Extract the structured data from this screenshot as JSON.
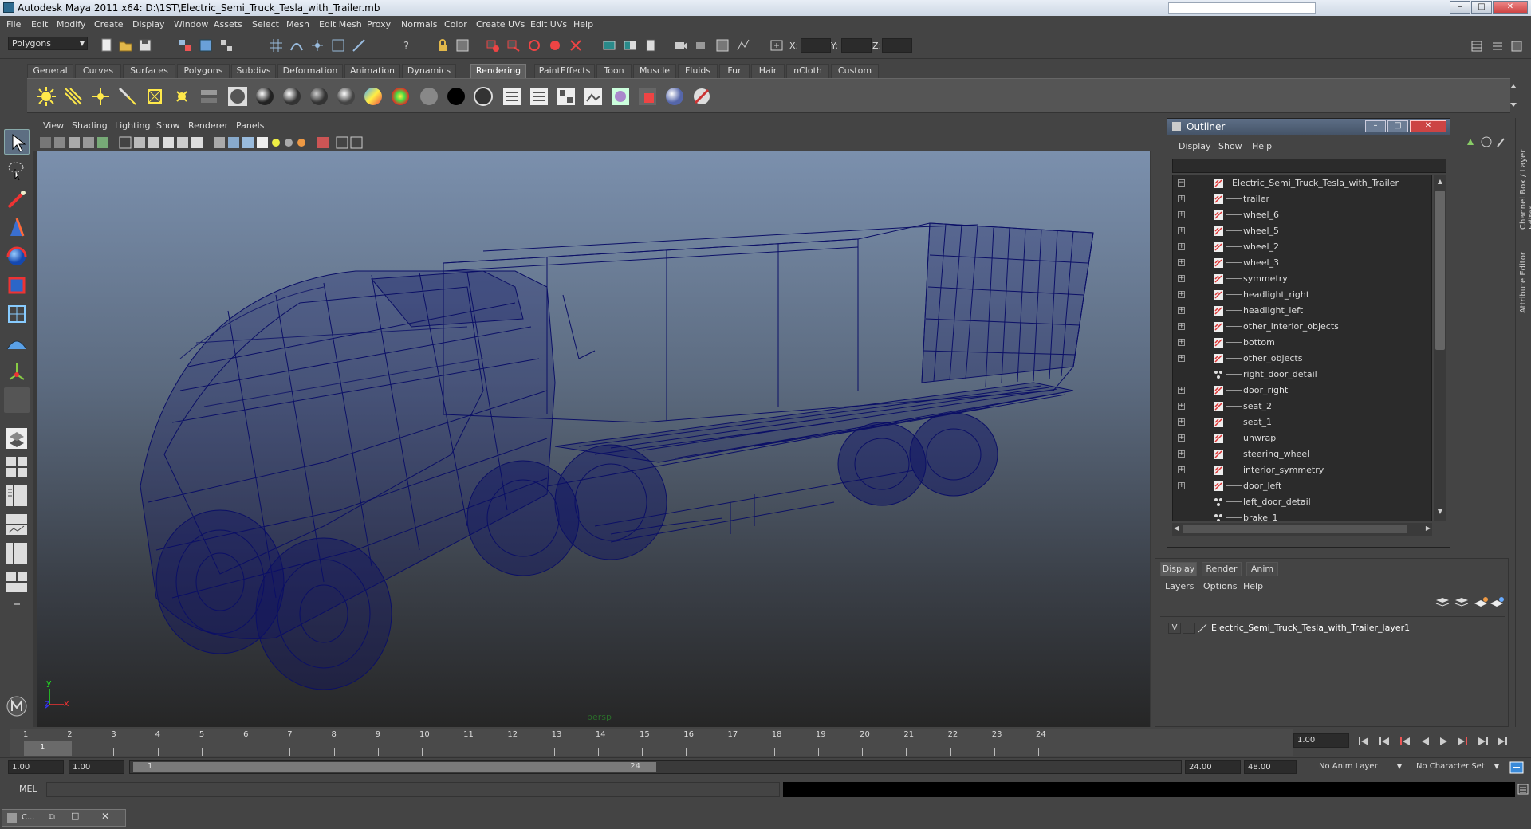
{
  "window": {
    "title": "Autodesk Maya 2011 x64: D:\\1ST\\Electric_Semi_Truck_Tesla_with_Trailer.mb"
  },
  "menubar": [
    "File",
    "Edit",
    "Modify",
    "Create",
    "Display",
    "Window",
    "Assets",
    "Select",
    "Mesh",
    "Edit Mesh",
    "Proxy",
    "Normals",
    "Color",
    "Create UVs",
    "Edit UVs",
    "Help"
  ],
  "statusline": {
    "mode": "Polygons",
    "x_label": "X:",
    "y_label": "Y:",
    "z_label": "Z:"
  },
  "shelf_tabs": [
    "General",
    "Curves",
    "Surfaces",
    "Polygons",
    "Subdivs",
    "Deformation",
    "Animation",
    "Dynamics",
    "Rendering",
    "PaintEffects",
    "Toon",
    "Muscle",
    "Fluids",
    "Fur",
    "Hair",
    "nCloth",
    "Custom"
  ],
  "active_shelf": "Rendering",
  "viewport": {
    "menus": [
      "View",
      "Shading",
      "Lighting",
      "Show",
      "Renderer",
      "Panels"
    ],
    "camera_label": "persp",
    "axis_y": "y",
    "axis_x": "x",
    "axis_z": "z"
  },
  "outliner": {
    "title": "Outliner",
    "menus": [
      "Display",
      "Show",
      "Help"
    ],
    "root": "Electric_Semi_Truck_Tesla_with_Trailer",
    "items": [
      {
        "name": "trailer",
        "type": "mesh"
      },
      {
        "name": "wheel_6",
        "type": "mesh"
      },
      {
        "name": "wheel_5",
        "type": "mesh"
      },
      {
        "name": "wheel_2",
        "type": "mesh"
      },
      {
        "name": "wheel_3",
        "type": "mesh"
      },
      {
        "name": "symmetry",
        "type": "mesh"
      },
      {
        "name": "headlight_right",
        "type": "mesh"
      },
      {
        "name": "headlight_left",
        "type": "mesh"
      },
      {
        "name": "other_interior_objects",
        "type": "mesh"
      },
      {
        "name": "bottom",
        "type": "mesh"
      },
      {
        "name": "other_objects",
        "type": "mesh"
      },
      {
        "name": "right_door_detail",
        "type": "group"
      },
      {
        "name": "door_right",
        "type": "mesh"
      },
      {
        "name": "seat_2",
        "type": "mesh"
      },
      {
        "name": "seat_1",
        "type": "mesh"
      },
      {
        "name": "unwrap",
        "type": "mesh"
      },
      {
        "name": "steering_wheel",
        "type": "mesh"
      },
      {
        "name": "interior_symmetry",
        "type": "mesh"
      },
      {
        "name": "door_left",
        "type": "mesh"
      },
      {
        "name": "left_door_detail",
        "type": "group"
      },
      {
        "name": "brake_1",
        "type": "group"
      }
    ]
  },
  "right_strip": {
    "channel_box": "Channel Box / Layer Editor",
    "attribute_editor": "Attribute Editor"
  },
  "layer_editor": {
    "tabs": [
      "Display",
      "Render",
      "Anim"
    ],
    "menus": [
      "Layers",
      "Options",
      "Help"
    ],
    "layer_visibility": "V",
    "layer_name": "Electric_Semi_Truck_Tesla_with_Trailer_layer1"
  },
  "timeline": {
    "start": 1,
    "end": 24,
    "current_frame": "1",
    "current_time_field": "1.00"
  },
  "range": {
    "start_time": "1.00",
    "playback_start": "1.00",
    "slider_start": "1",
    "slider_end": "24",
    "playback_end": "24.00",
    "end_time": "48.00",
    "anim_layer": "No Anim Layer",
    "character_set": "No Character Set"
  },
  "command_line": {
    "label": "MEL"
  },
  "taskbar": {
    "item": "C..."
  },
  "colors": {
    "wireframe": "#0b0f66",
    "active_tab": "#5e5e5e",
    "selection": "#5d6e82"
  }
}
